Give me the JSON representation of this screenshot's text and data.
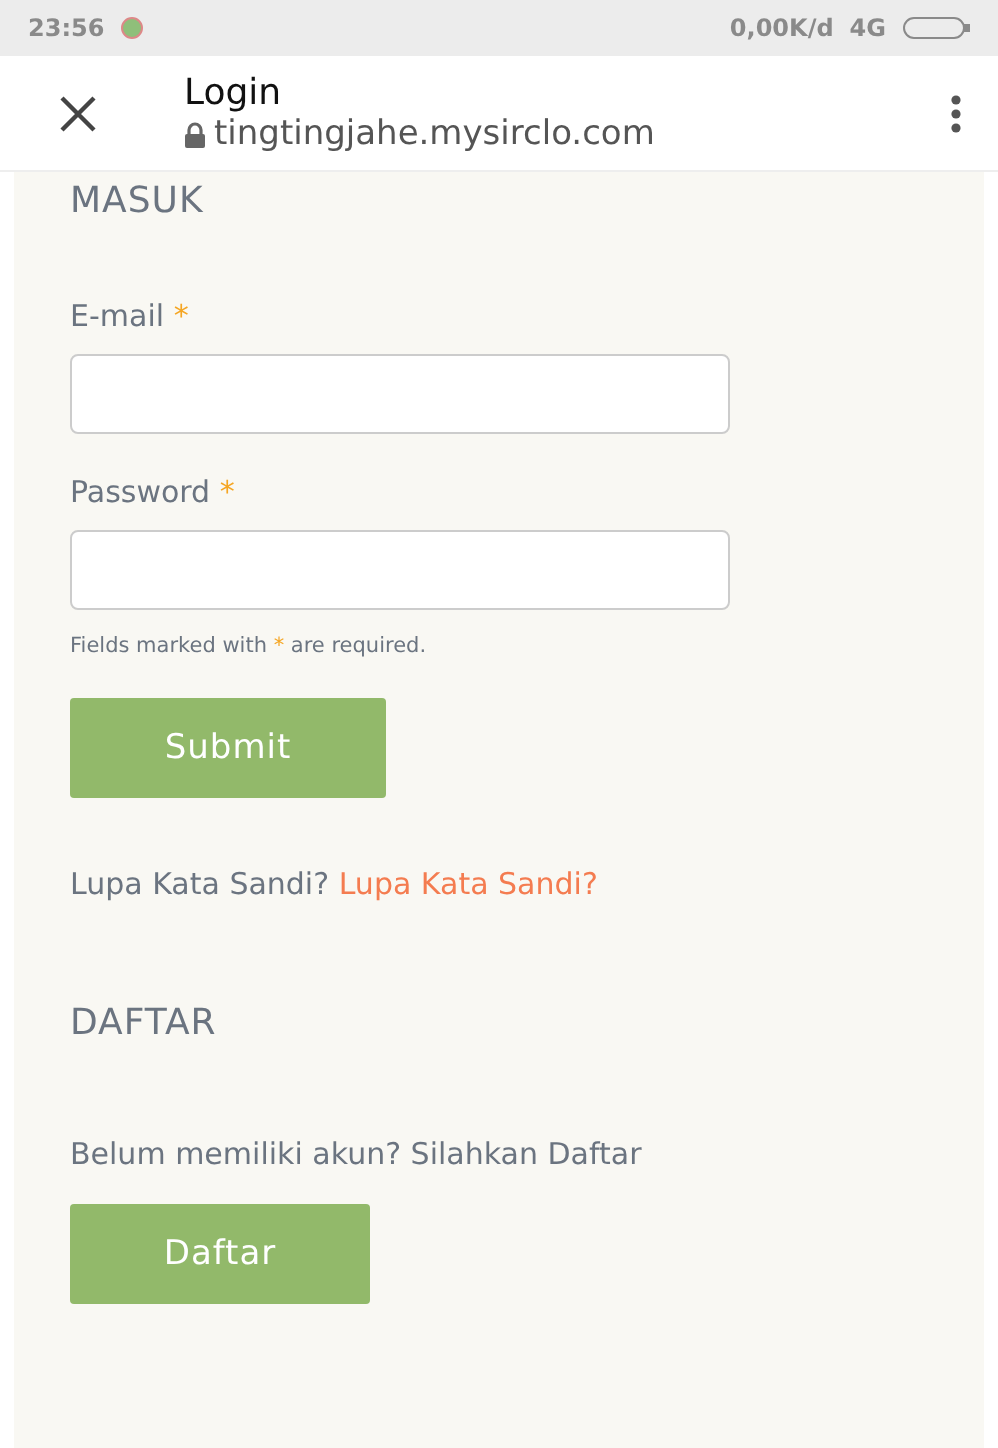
{
  "status_bar": {
    "time": "23:56",
    "speed": "0,00K/d",
    "network": "4G"
  },
  "toolbar": {
    "title": "Login",
    "url": "tingtingjahe.mysirclo.com"
  },
  "login": {
    "heading": "MASUK",
    "fields": [
      {
        "label": "E-mail",
        "required_mark": "*"
      },
      {
        "label": "Password",
        "required_mark": "*"
      }
    ],
    "required_note": {
      "before": "Fields marked with",
      "mark": "*",
      "after": "are required."
    },
    "submit": "Submit",
    "forgot": {
      "text": "Lupa Kata Sandi?",
      "link": "Lupa Kata Sandi?"
    }
  },
  "register": {
    "heading": "DAFTAR",
    "text": "Belum memiliki akun? Silahkan Daftar",
    "button": "Daftar"
  }
}
